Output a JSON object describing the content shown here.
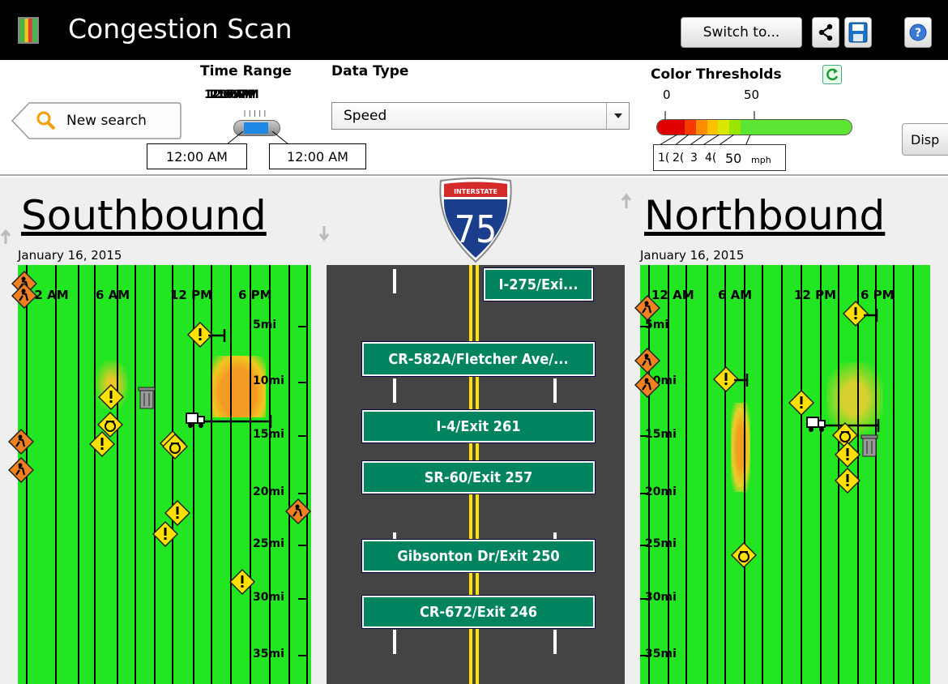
{
  "header": {
    "title": "Congestion Scan",
    "switch_label": "Switch to..."
  },
  "controls": {
    "new_search_label": "New search",
    "time_range_label": "Time Range",
    "time_range_overlap": [
      "12:00 AM",
      "12:00 PM",
      "11:59 PM"
    ],
    "start_time": "12:00 AM",
    "end_time": "12:00 AM",
    "data_type_label": "Data Type",
    "data_type_value": "Speed",
    "color_thresholds_label": "Color Thresholds",
    "threshold_min": "0",
    "threshold_mid": "50",
    "threshold_boxes": [
      "1(",
      "2(",
      "3",
      "4(",
      "50",
      "mph"
    ],
    "display_button_label": "Disp",
    "threshold_colors": [
      "#e00000",
      "#f53a00",
      "#ff8c00",
      "#ffc000",
      "#d8e800",
      "#9be600",
      "#5ae633"
    ]
  },
  "southbound": {
    "title": "Southbound",
    "date": "January 16, 2015",
    "hours": [
      "12 AM",
      "6 AM",
      "12 PM",
      "6 PM"
    ],
    "miles": [
      "5mi",
      "10mi",
      "15mi",
      "20mi",
      "25mi",
      "30mi",
      "35mi"
    ]
  },
  "northbound": {
    "title": "Northbound",
    "date": "January 16, 2015",
    "hours": [
      "12 AM",
      "6 AM",
      "12 PM",
      "6 PM"
    ],
    "miles": [
      "5mi",
      "10mi",
      "15mi",
      "20mi",
      "25mi",
      "30mi",
      "35mi"
    ]
  },
  "road": {
    "shield_label": "INTERSTATE",
    "shield_number": "75",
    "exits": [
      "I-275/Exi...",
      "CR-582A/Fletcher Ave/...",
      "I-4/Exit 261",
      "SR-60/Exit 257",
      "Gibsonton Dr/Exit 250",
      "CR-672/Exit 246"
    ]
  },
  "colors": {
    "flow_green": "#22e622",
    "sign_green": "#00845f",
    "road_gray": "#444444",
    "lane_yellow": "#ffe000",
    "warning_yellow": "#ffe000",
    "congestion_orange": "#f5a023"
  },
  "icons": [
    "app-logo-icon",
    "search-icon",
    "share-icon",
    "save-icon",
    "help-icon",
    "refresh-icon",
    "warning-icon",
    "construction-icon",
    "disabled-vehicle-icon",
    "trash-icon",
    "truck-icon"
  ]
}
